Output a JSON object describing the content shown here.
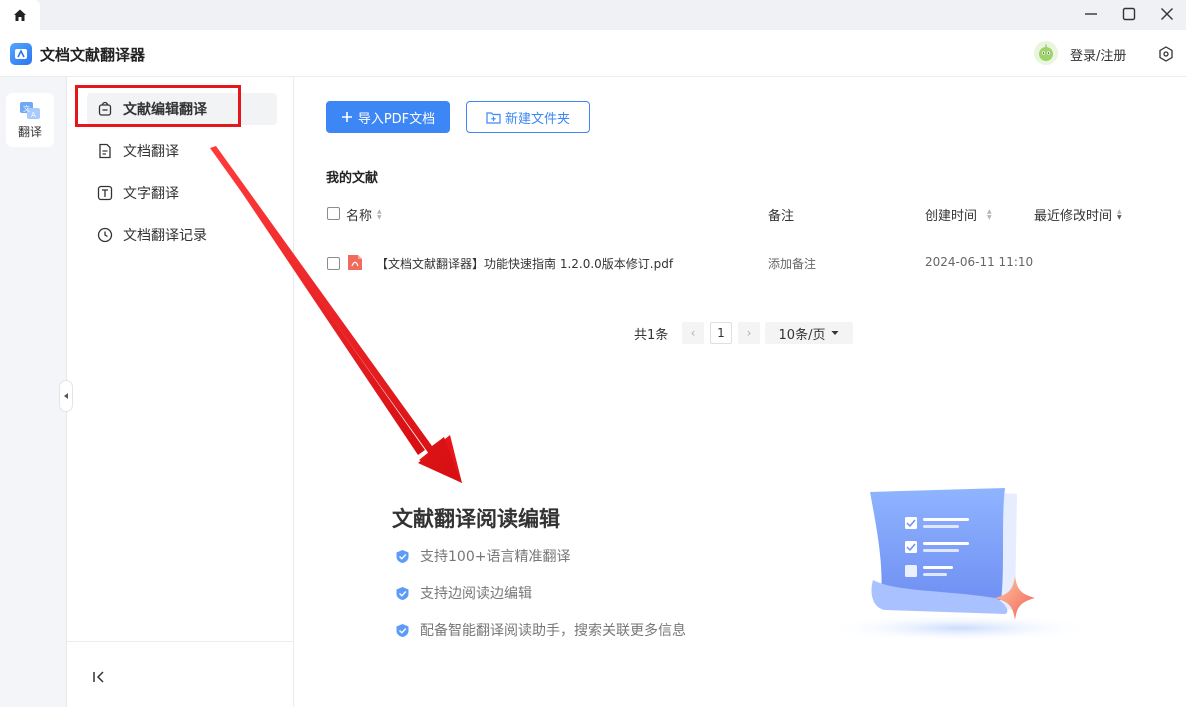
{
  "app": {
    "title": "文档文献翻译器"
  },
  "header": {
    "login_label": "登录/注册"
  },
  "rail": {
    "translate_label": "翻译"
  },
  "sidebar": {
    "items": [
      {
        "label": "文献编辑翻译",
        "icon": "bag-icon"
      },
      {
        "label": "文档翻译",
        "icon": "document-icon"
      },
      {
        "label": "文字翻译",
        "icon": "text-icon"
      },
      {
        "label": "文档翻译记录",
        "icon": "clock-icon"
      }
    ]
  },
  "toolbar": {
    "import_label": "导入PDF文档",
    "new_folder_label": "新建文件夹"
  },
  "files": {
    "section_title": "我的文献",
    "columns": {
      "name": "名称",
      "note": "备注",
      "created": "创建时间",
      "modified": "最近修改时间"
    },
    "rows": [
      {
        "name": "【文档文献翻译器】功能快速指南 1.2.0.0版本修订.pdf",
        "note": "添加备注",
        "created": "2024-06-11 11:10",
        "modified": ""
      }
    ]
  },
  "pagination": {
    "total": "共1条",
    "prev": "‹",
    "current": "1",
    "next": "›",
    "page_size": "10条/页"
  },
  "promo": {
    "title": "文献翻译阅读编辑",
    "features": [
      "支持100+语言精准翻译",
      "支持边阅读边编辑",
      "配备智能翻译阅读助手，搜索关联更多信息"
    ]
  },
  "colors": {
    "accent": "#3d86f5",
    "highlight": "#e5161c",
    "arrow": "#e8141a"
  }
}
